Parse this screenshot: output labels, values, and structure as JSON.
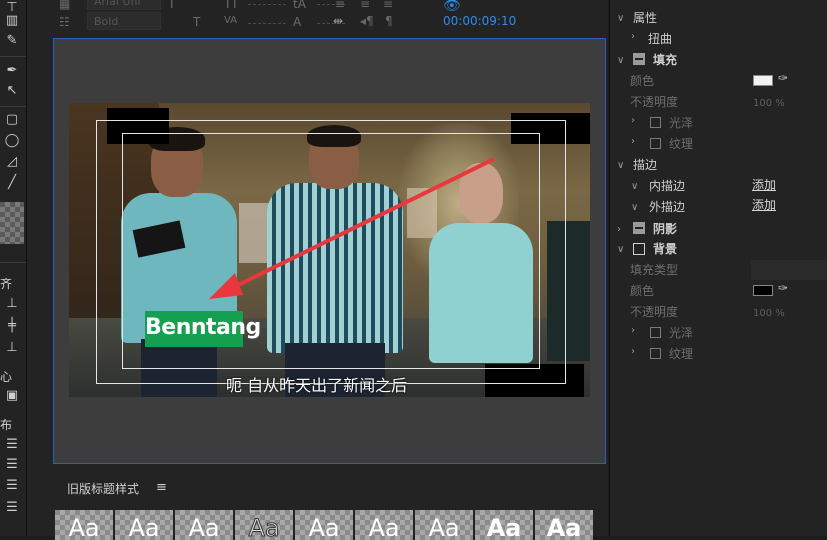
{
  "top_toolbar": {
    "font_family": "Arial Uni",
    "font_style": "Bold",
    "timecode": "00:00:09:10"
  },
  "left_tools": {
    "align_label": "齐",
    "center_label": "心",
    "distribute_label": "布"
  },
  "monitor": {
    "brand_text": "Benntang",
    "subtitle": "呃 自从昨天出了新闻之后",
    "brand_color": "#15a050",
    "arrow_color": "#e8383d"
  },
  "styles_panel": {
    "title": "旧版标题样式",
    "menu_icon": "≡",
    "samples": [
      "Aa",
      "Aa",
      "Aa",
      "Aa",
      "Aa",
      "Aa",
      "Aa",
      "Aa",
      "Aa"
    ]
  },
  "properties": {
    "section_attributes": "属性",
    "distort": "扭曲",
    "fill": "填充",
    "color": "颜色",
    "opacity": "不透明度",
    "opacity_value": "100 %",
    "sheen": "光泽",
    "texture": "纹理",
    "stroke": "描边",
    "inner_stroke": "内描边",
    "outer_stroke": "外描边",
    "add": "添加",
    "shadow": "阴影",
    "background": "背景",
    "fill_type": "填充类型",
    "bg_color": "颜色",
    "bg_opacity": "不透明度",
    "bg_opacity_value": "100 %",
    "bg_sheen": "光泽",
    "bg_texture": "纹理",
    "fill_swatch": "#f2f2f2",
    "bg_swatch": "#000000"
  }
}
